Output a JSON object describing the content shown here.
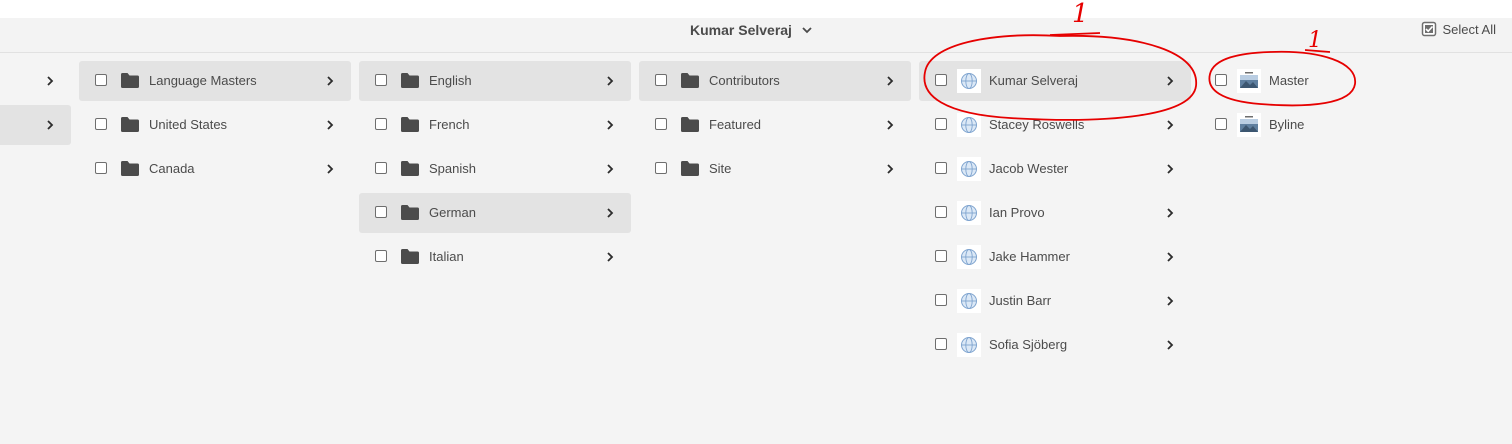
{
  "header": {
    "title": "Kumar Selveraj",
    "select_all_label": "Select All"
  },
  "columns": [
    {
      "items": [
        {
          "label": "Language Masters",
          "type": "folder",
          "selected": true
        },
        {
          "label": "United States",
          "type": "folder",
          "selected": false
        },
        {
          "label": "Canada",
          "type": "folder",
          "selected": false
        }
      ]
    },
    {
      "items": [
        {
          "label": "English",
          "type": "folder",
          "selected": true
        },
        {
          "label": "French",
          "type": "folder",
          "selected": false
        },
        {
          "label": "Spanish",
          "type": "folder",
          "selected": false
        },
        {
          "label": "German",
          "type": "folder",
          "selected": true
        },
        {
          "label": "Italian",
          "type": "folder",
          "selected": false
        }
      ]
    },
    {
      "items": [
        {
          "label": "Contributors",
          "type": "folder",
          "selected": true
        },
        {
          "label": "Featured",
          "type": "folder",
          "selected": false
        },
        {
          "label": "Site",
          "type": "folder",
          "selected": false
        }
      ]
    },
    {
      "items": [
        {
          "label": "Kumar Selveraj",
          "type": "page",
          "selected": true
        },
        {
          "label": "Stacey Roswells",
          "type": "page",
          "selected": false
        },
        {
          "label": "Jacob Wester",
          "type": "page",
          "selected": false
        },
        {
          "label": "Ian Provo",
          "type": "page",
          "selected": false
        },
        {
          "label": "Jake Hammer",
          "type": "page",
          "selected": false
        },
        {
          "label": "Justin Barr",
          "type": "page",
          "selected": false
        },
        {
          "label": "Sofia Sjöberg",
          "type": "page",
          "selected": false
        }
      ]
    },
    {
      "items": [
        {
          "label": "Master",
          "type": "variation",
          "selected": false
        },
        {
          "label": "Byline",
          "type": "variation",
          "selected": false
        }
      ]
    }
  ],
  "annotations": [
    {
      "text": "1",
      "color": "#e60000"
    },
    {
      "text": "1",
      "color": "#e60000"
    }
  ]
}
